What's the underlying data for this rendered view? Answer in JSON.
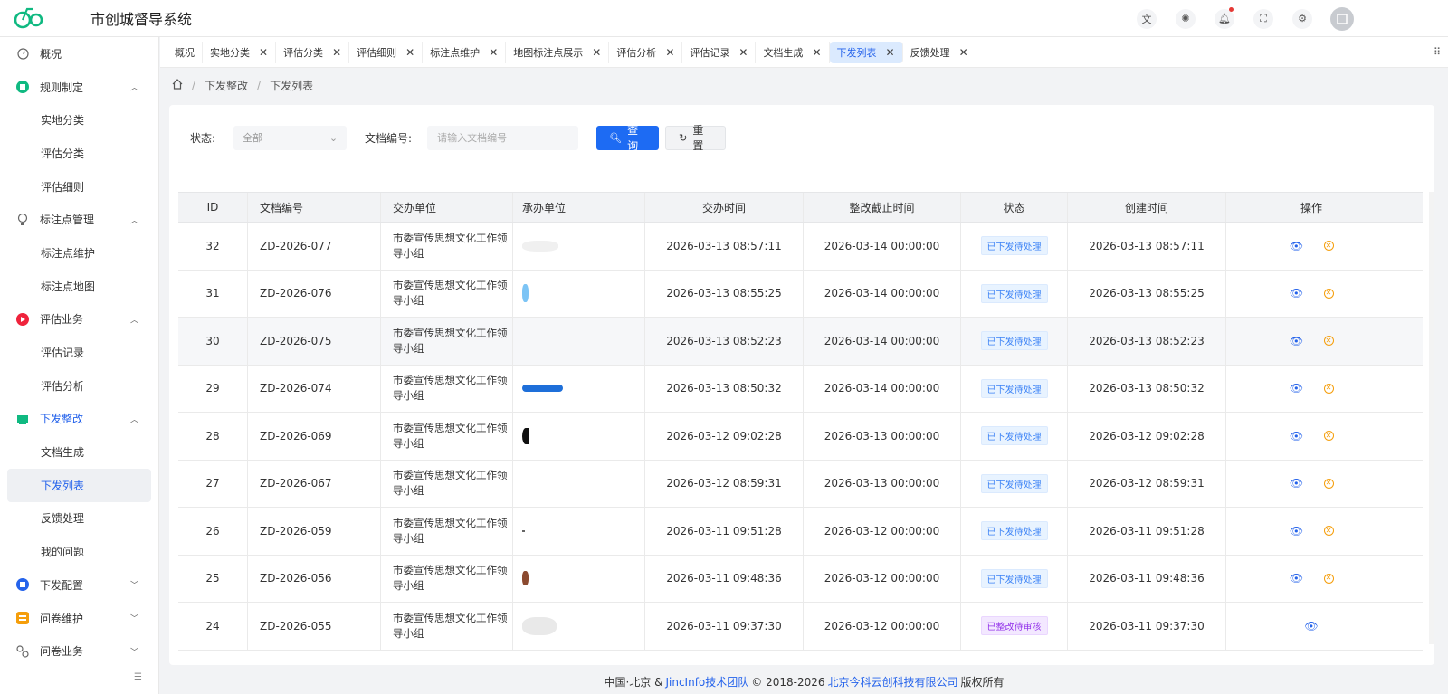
{
  "app": {
    "title": "市创城督导系统",
    "logo": "GO"
  },
  "header_icons": [
    "translate-icon",
    "theme-icon",
    "bell-icon",
    "fullscreen-icon",
    "gear-icon",
    "avatar"
  ],
  "sidebar": {
    "items": [
      {
        "label": "概况",
        "icon": "dashboard-icon",
        "level": 0
      },
      {
        "label": "规则制定",
        "icon": "rules-icon",
        "level": 0,
        "expanded": true
      },
      {
        "label": "实地分类",
        "level": 1
      },
      {
        "label": "评估分类",
        "level": 1
      },
      {
        "label": "评估细则",
        "level": 1
      },
      {
        "label": "标注点管理",
        "icon": "bulb-icon",
        "level": 0,
        "expanded": true
      },
      {
        "label": "标注点维护",
        "level": 1
      },
      {
        "label": "标注点地图",
        "level": 1
      },
      {
        "label": "评估业务",
        "icon": "play-icon",
        "level": 0,
        "expanded": true
      },
      {
        "label": "评估记录",
        "level": 1
      },
      {
        "label": "评估分析",
        "level": 1
      },
      {
        "label": "下发整改",
        "icon": "dispatch-icon",
        "level": 0,
        "expanded": true
      },
      {
        "label": "文档生成",
        "level": 1
      },
      {
        "label": "下发列表",
        "level": 1,
        "active": true
      },
      {
        "label": "反馈处理",
        "level": 1
      },
      {
        "label": "我的问题",
        "level": 1
      },
      {
        "label": "下发配置",
        "icon": "config-icon",
        "level": 0,
        "expanded": false
      },
      {
        "label": "问卷维护",
        "icon": "survey-icon",
        "level": 0,
        "expanded": false
      },
      {
        "label": "问卷业务",
        "icon": "survey-biz-icon",
        "level": 0,
        "expanded": false
      }
    ]
  },
  "tabs": [
    {
      "label": "概况",
      "closable": false
    },
    {
      "label": "实地分类",
      "closable": true
    },
    {
      "label": "评估分类",
      "closable": true
    },
    {
      "label": "评估细则",
      "closable": true
    },
    {
      "label": "标注点维护",
      "closable": true
    },
    {
      "label": "地图标注点展示",
      "closable": true
    },
    {
      "label": "评估分析",
      "closable": true
    },
    {
      "label": "评估记录",
      "closable": true
    },
    {
      "label": "文档生成",
      "closable": true
    },
    {
      "label": "下发列表",
      "closable": true,
      "active": true
    },
    {
      "label": "反馈处理",
      "closable": true
    }
  ],
  "breadcrumb": {
    "items": [
      "下发整改",
      "下发列表"
    ]
  },
  "search": {
    "status_label": "状态:",
    "status_value": "全部",
    "doc_label": "文档编号:",
    "doc_placeholder": "请输入文档编号",
    "query_button": "查询",
    "reset_button": "重置"
  },
  "table": {
    "headers": [
      "ID",
      "文档编号",
      "交办单位",
      "承办单位",
      "交办时间",
      "整改截止时间",
      "状态",
      "创建时间",
      "操作"
    ],
    "rows": [
      {
        "id": "32",
        "doc": "ZD-2026-077",
        "from": "市委宣传思想文化工作领导小组",
        "to": "",
        "time": "2026-03-13 08:57:11",
        "deadline": "2026-03-14 00:00:00",
        "status": "已下发待处理",
        "created": "2026-03-13 08:57:11",
        "cancel": true
      },
      {
        "id": "31",
        "doc": "ZD-2026-076",
        "from": "市委宣传思想文化工作领导小组",
        "to": "",
        "time": "2026-03-13 08:55:25",
        "deadline": "2026-03-14 00:00:00",
        "status": "已下发待处理",
        "created": "2026-03-13 08:55:25",
        "cancel": true
      },
      {
        "id": "30",
        "doc": "ZD-2026-075",
        "from": "市委宣传思想文化工作领导小组",
        "to": "",
        "time": "2026-03-13 08:52:23",
        "deadline": "2026-03-14 00:00:00",
        "status": "已下发待处理",
        "created": "2026-03-13 08:52:23",
        "cancel": true
      },
      {
        "id": "29",
        "doc": "ZD-2026-074",
        "from": "市委宣传思想文化工作领导小组",
        "to": "",
        "time": "2026-03-13 08:50:32",
        "deadline": "2026-03-14 00:00:00",
        "status": "已下发待处理",
        "created": "2026-03-13 08:50:32",
        "cancel": true
      },
      {
        "id": "28",
        "doc": "ZD-2026-069",
        "from": "市委宣传思想文化工作领导小组",
        "to": "",
        "time": "2026-03-12 09:02:28",
        "deadline": "2026-03-13 00:00:00",
        "status": "已下发待处理",
        "created": "2026-03-12 09:02:28",
        "cancel": true
      },
      {
        "id": "27",
        "doc": "ZD-2026-067",
        "from": "市委宣传思想文化工作领导小组",
        "to": "",
        "time": "2026-03-12 08:59:31",
        "deadline": "2026-03-13 00:00:00",
        "status": "已下发待处理",
        "created": "2026-03-12 08:59:31",
        "cancel": true
      },
      {
        "id": "26",
        "doc": "ZD-2026-059",
        "from": "市委宣传思想文化工作领导小组",
        "to": "",
        "time": "2026-03-11 09:51:28",
        "deadline": "2026-03-12 00:00:00",
        "status": "已下发待处理",
        "created": "2026-03-11 09:51:28",
        "cancel": true
      },
      {
        "id": "25",
        "doc": "ZD-2026-056",
        "from": "市委宣传思想文化工作领导小组",
        "to": "",
        "time": "2026-03-11 09:48:36",
        "deadline": "2026-03-12 00:00:00",
        "status": "已下发待处理",
        "created": "2026-03-11 09:48:36",
        "cancel": true
      },
      {
        "id": "24",
        "doc": "ZD-2026-055",
        "from": "市委宣传思想文化工作领导小组",
        "to": "",
        "time": "2026-03-11 09:37:30",
        "deadline": "2026-03-12 00:00:00",
        "status": "已整改待审核",
        "created": "2026-03-11 09:37:30",
        "cancel": false
      }
    ]
  },
  "footer": {
    "prefix": "中国·北京 &",
    "team": "JincInfo技术团队",
    "copyright": "© 2018-2026",
    "company": "北京今科云创科技有限公司",
    "suffix": "版权所有"
  },
  "colors": {
    "primary": "#1d6bf3",
    "tag_blue": "#3b82f6",
    "tag_purple": "#9333ea",
    "warn": "#f59e0b"
  }
}
